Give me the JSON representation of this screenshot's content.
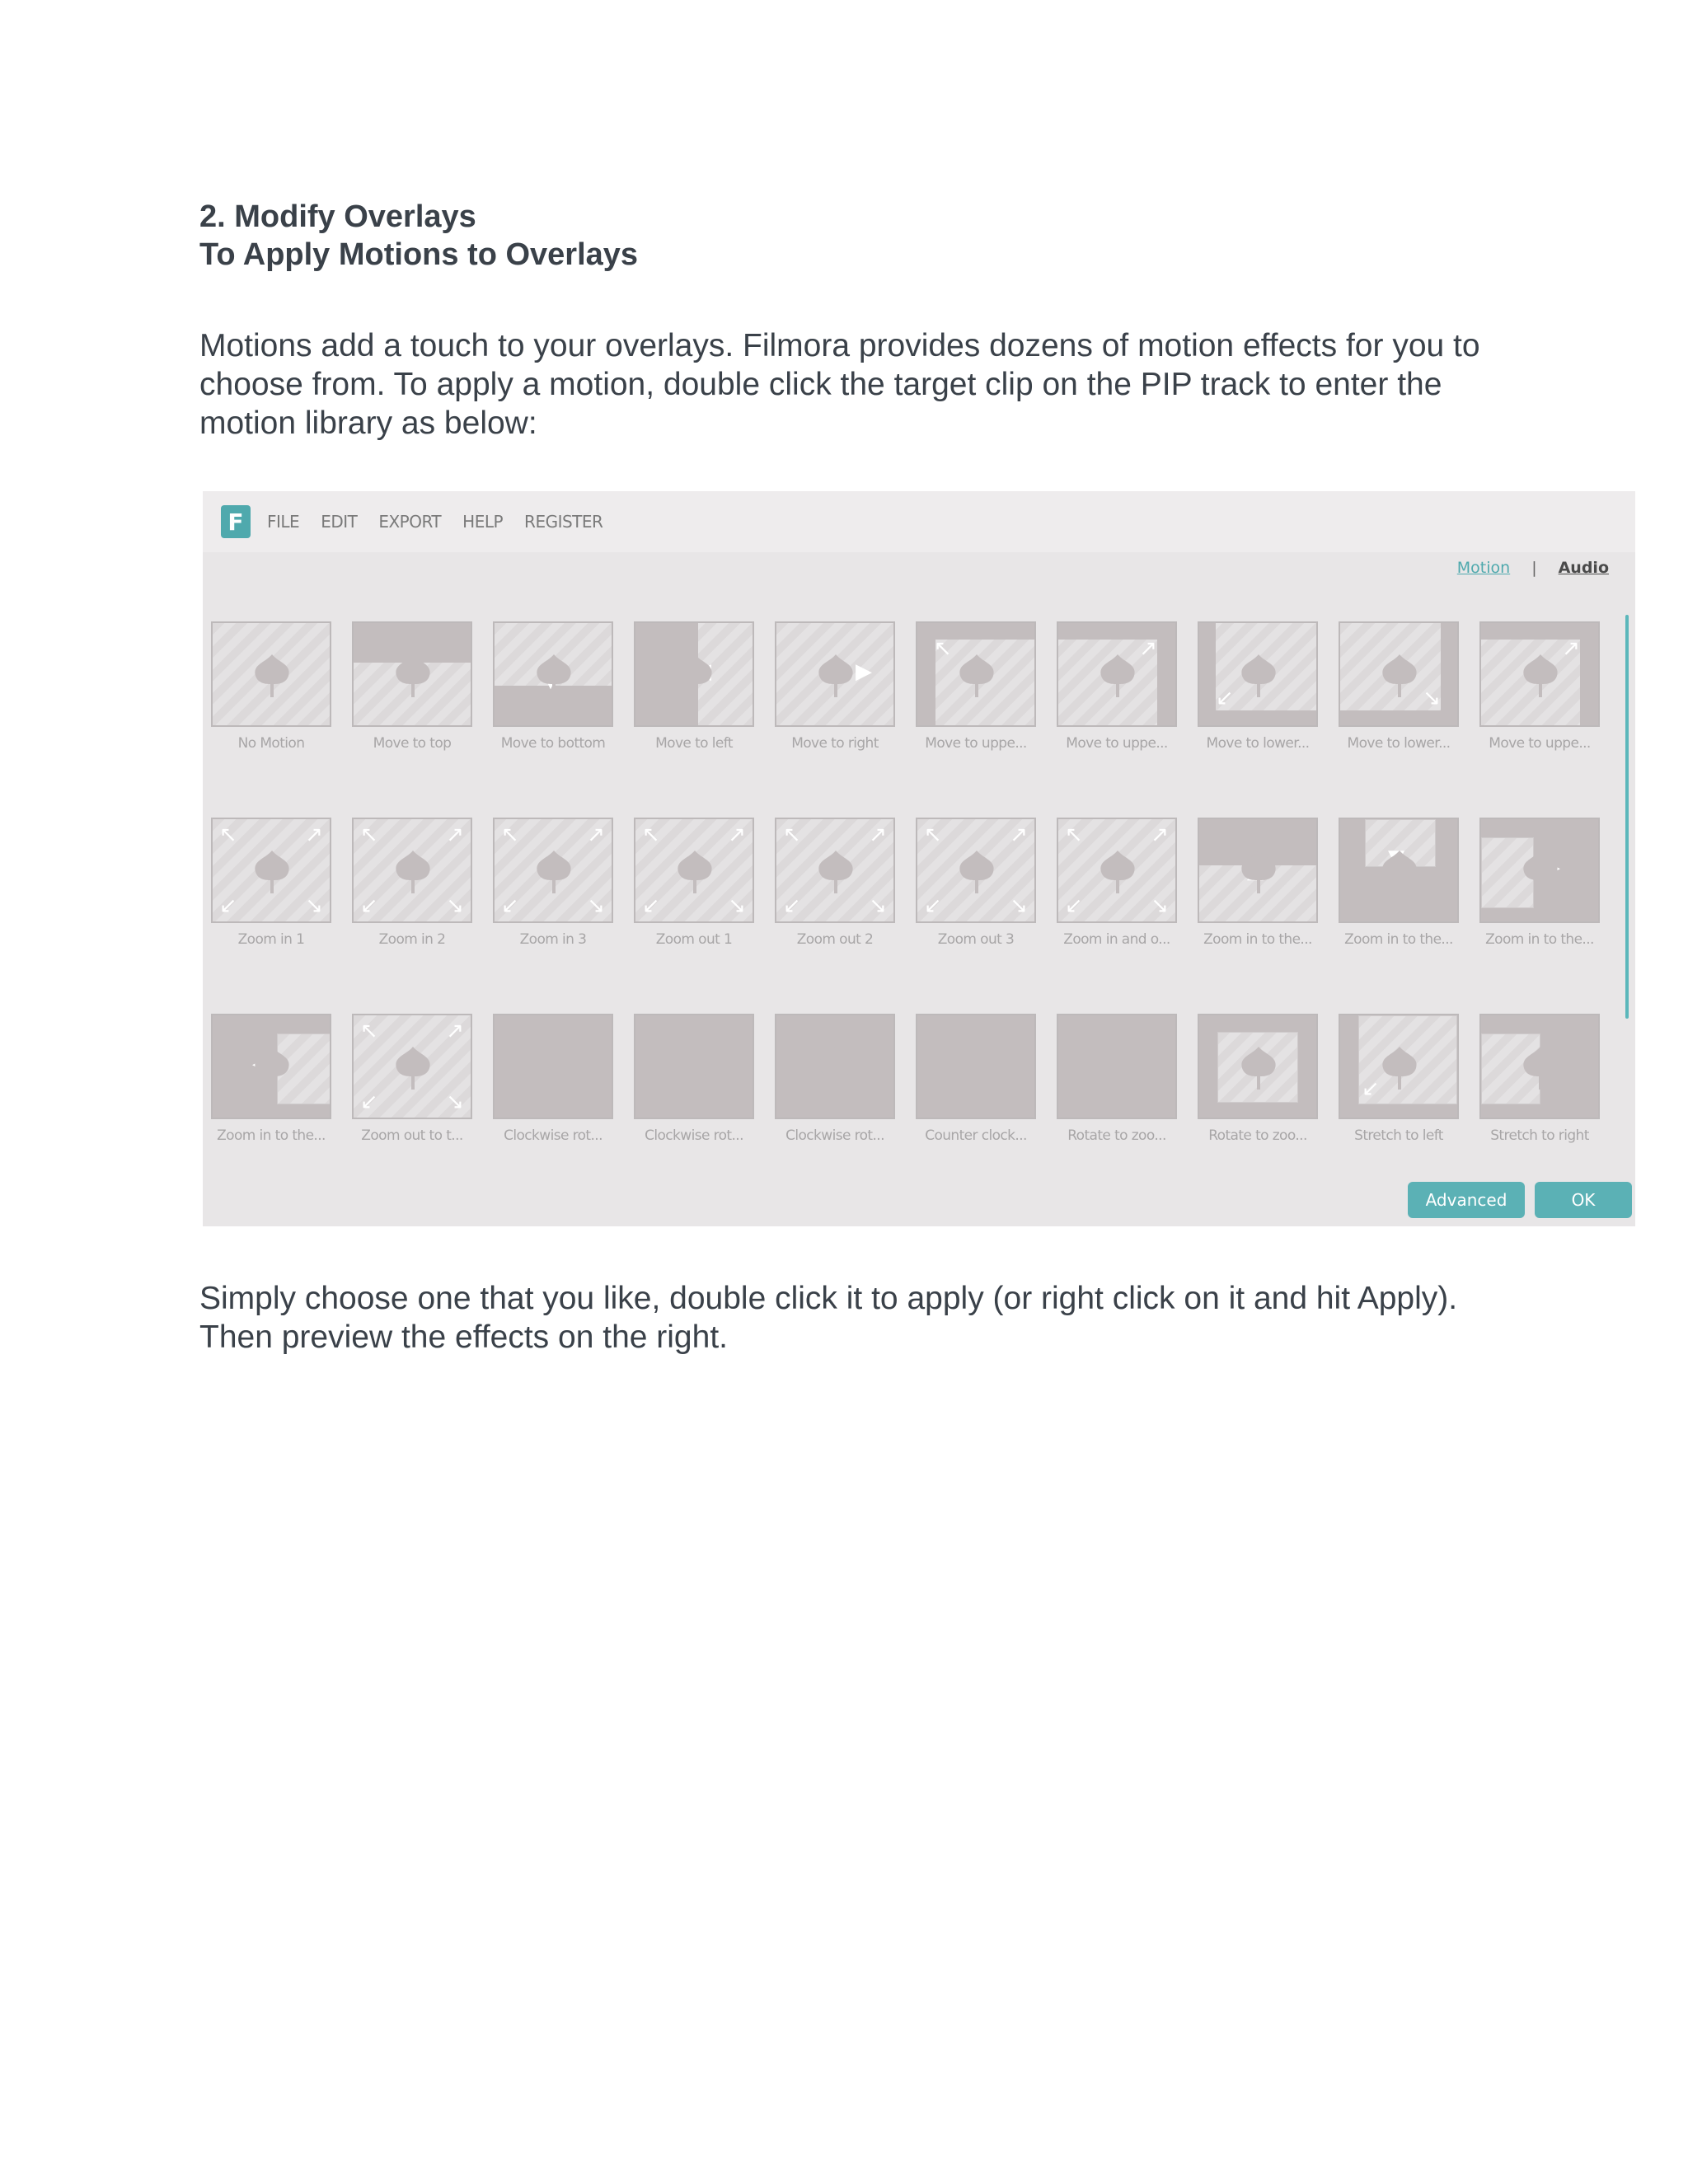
{
  "heading": {
    "section": "2. Modify Overlays",
    "subsection": "To Apply Motions to Overlays"
  },
  "intro_paragraph": "Motions add a touch to your overlays. Filmora provides dozens of motion effects for you to choose from. To apply a motion, double click the target clip on the PIP track to enter the motion library as below:",
  "outro_paragraph": "Simply choose one that you like, double click it to apply (or right click on it and hit Apply). Then preview the effects on the right.",
  "app": {
    "logo_letter": "F",
    "menu": [
      "FILE",
      "EDIT",
      "EXPORT",
      "HELP",
      "REGISTER"
    ],
    "tabs": {
      "motion": "Motion",
      "separator": "|",
      "audio": "Audio"
    },
    "motions": [
      "No Motion",
      "Move to top",
      "Move to bottom",
      "Move to left",
      "Move to right",
      "Move to uppe...",
      "Move to uppe...",
      "Move to lower...",
      "Move to lower...",
      "Move to uppe...",
      "Zoom in 1",
      "Zoom in 2",
      "Zoom in 3",
      "Zoom out 1",
      "Zoom out 2",
      "Zoom out 3",
      "Zoom in and o...",
      "Zoom in to the...",
      "Zoom in to the...",
      "Zoom in to the...",
      "Zoom in to the...",
      "Zoom out to t...",
      "Clockwise rot...",
      "Clockwise rot...",
      "Clockwise rot...",
      "Counter clock...",
      "Rotate to zoo...",
      "Rotate to zoo...",
      "Stretch to left",
      "Stretch to right"
    ],
    "buttons": {
      "advanced": "Advanced",
      "ok": "OK"
    },
    "colors": {
      "accent": "#5bb1b5",
      "tile_border": "#bdb9ba",
      "tile_dark": "#c3bdbe"
    }
  }
}
